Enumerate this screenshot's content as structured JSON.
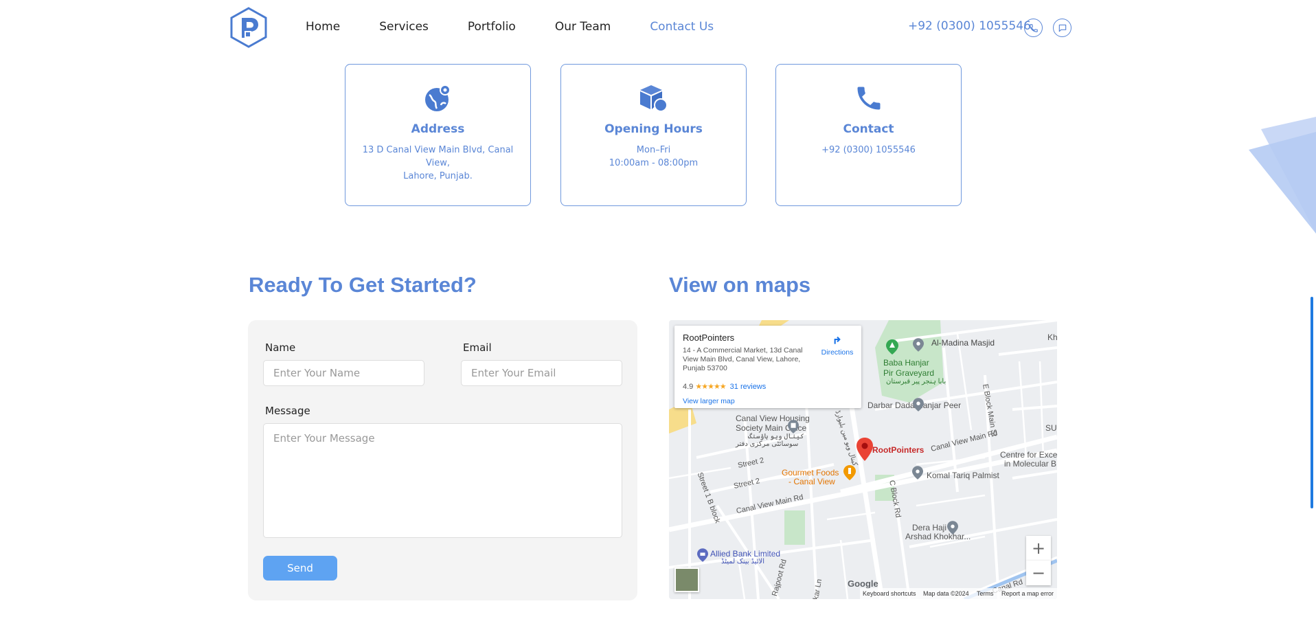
{
  "header": {
    "logo_icon": "rp-hexagon-logo",
    "nav": [
      "Home",
      "Services",
      "Portfolio",
      "Our Team",
      "Contact Us"
    ],
    "active_nav": "Contact Us",
    "phone": "+92 (0300) 1055546",
    "icons": [
      "phone-call-icon",
      "chat-icon"
    ]
  },
  "cards": [
    {
      "icon": "globe-location-icon",
      "title": "Address",
      "lines": [
        "13 D Canal View Main Blvd, Canal View,",
        "Lahore, Punjab."
      ]
    },
    {
      "icon": "box-clock-icon",
      "title": "Opening Hours",
      "lines": [
        "Mon–Fri",
        "10:00am - 08:00pm"
      ]
    },
    {
      "icon": "phone-icon",
      "title": "Contact",
      "lines": [
        "+92 (0300) 1055546",
        ""
      ]
    }
  ],
  "form": {
    "title": "Ready To Get Started?",
    "name_label": "Name",
    "name_placeholder": "Enter Your Name",
    "email_label": "Email",
    "email_placeholder": "Enter Your Email",
    "message_label": "Message",
    "message_placeholder": "Enter Your Message",
    "send_label": "Send"
  },
  "map": {
    "title": "View on maps",
    "place_name": "RootPointers",
    "place_address": "14 - A Commercial Market, 13d Canal View Main Blvd, Canal View, Lahore, Punjab 53700",
    "rating": "4.9",
    "stars": "★★★★★",
    "reviews": "31 reviews",
    "larger_map": "View larger map",
    "directions": "Directions",
    "labels": {
      "al_madina": "Al-Madina Masjid",
      "baba_hanjar": "Baba Hanjar",
      "pir_graveyard": "Pir Graveyard",
      "graveyard_urdu": "بابا ہنجر پیر قبرستان",
      "darbar": "Darbar Dada Hanjar Peer",
      "housing_1": "Canal View Housing",
      "housing_2": "Society Main Office",
      "housing_urdu_1": "کینال ویو ہاؤسنگ",
      "housing_urdu_2": "سوسائٹی مرکزی دفتر",
      "rootpointers": "RootPointers",
      "gourmet_1": "Gourmet Foods",
      "gourmet_2": "- Canal View",
      "komal": "Komal Tariq Palmist",
      "centre_1": "Centre for Exce",
      "centre_2": "in Molecular B",
      "dera_1": "Dera Haji",
      "dera_2": "Arshad Khokhar...",
      "allied": "Allied Bank Limited",
      "allied_urdu": "الائیڈ بینک لمیٹڈ",
      "street2a": "Street 2",
      "street2b": "Street 2",
      "street1b": "Street 1 B block",
      "canal_main_1": "Canal View Main Rd",
      "canal_main_2": "Canal View Main Rd",
      "canal_rd": "Canal Rd",
      "eblock": "E Block Main St",
      "cblock": "C Block Rd",
      "rajpoot": "Rajpoot Rd",
      "kar_ln": "kar Ln",
      "kh": "Kh",
      "su": "SU",
      "canal_urdu": "کینال ویو مین بلیوارڈ",
      "google": "Google"
    },
    "zoom_in": "+",
    "zoom_out": "−",
    "footer": [
      "Keyboard shortcuts",
      "Map data ©2024",
      "Terms",
      "Report a map error"
    ]
  },
  "colors": {
    "accent": "#5a86d6",
    "button": "#5ea3f2",
    "pin": "#ea4335"
  }
}
